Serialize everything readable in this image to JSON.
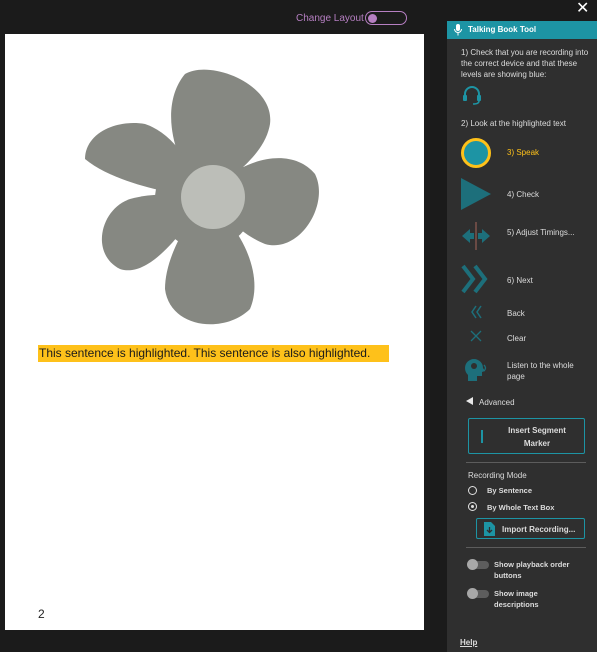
{
  "top": {
    "change_layout": "Change Layout"
  },
  "page": {
    "highlighted_text": "This sentence is highlighted. This sentence is also highlighted.",
    "page_number": "2"
  },
  "panel": {
    "title": "Talking Book Tool",
    "step1": "1) Check that you are recording into the correct device and that these levels are showing blue:",
    "step2": "2) Look at the highlighted text",
    "speak": "3) Speak",
    "check": "4) Check",
    "adjust": "5) Adjust Timings...",
    "next": "6) Next",
    "back": "Back",
    "clear": "Clear",
    "listen": "Listen to the whole page",
    "advanced": "Advanced",
    "insert_marker": "Insert Segment Marker",
    "recording_mode": "Recording Mode",
    "by_sentence": "By Sentence",
    "by_textbox": "By Whole Text Box",
    "import_recording": "Import Recording...",
    "show_playback": "Show playback order buttons",
    "show_image_desc": "Show image descriptions",
    "help": "Help"
  },
  "colors": {
    "accent": "#1d94a4",
    "speak_ring": "#fec11a",
    "highlight": "#fec11a",
    "flower": "#868882",
    "flower_center": "#bcbeb8",
    "toggle": "#b67fc2"
  },
  "icons": [
    "close-icon",
    "microphone-icon",
    "headset-icon",
    "speak-icon",
    "play-icon",
    "adjust-timings-icon",
    "next-icon",
    "back-icon",
    "clear-icon",
    "listen-head-icon",
    "triangle-icon",
    "import-icon"
  ]
}
